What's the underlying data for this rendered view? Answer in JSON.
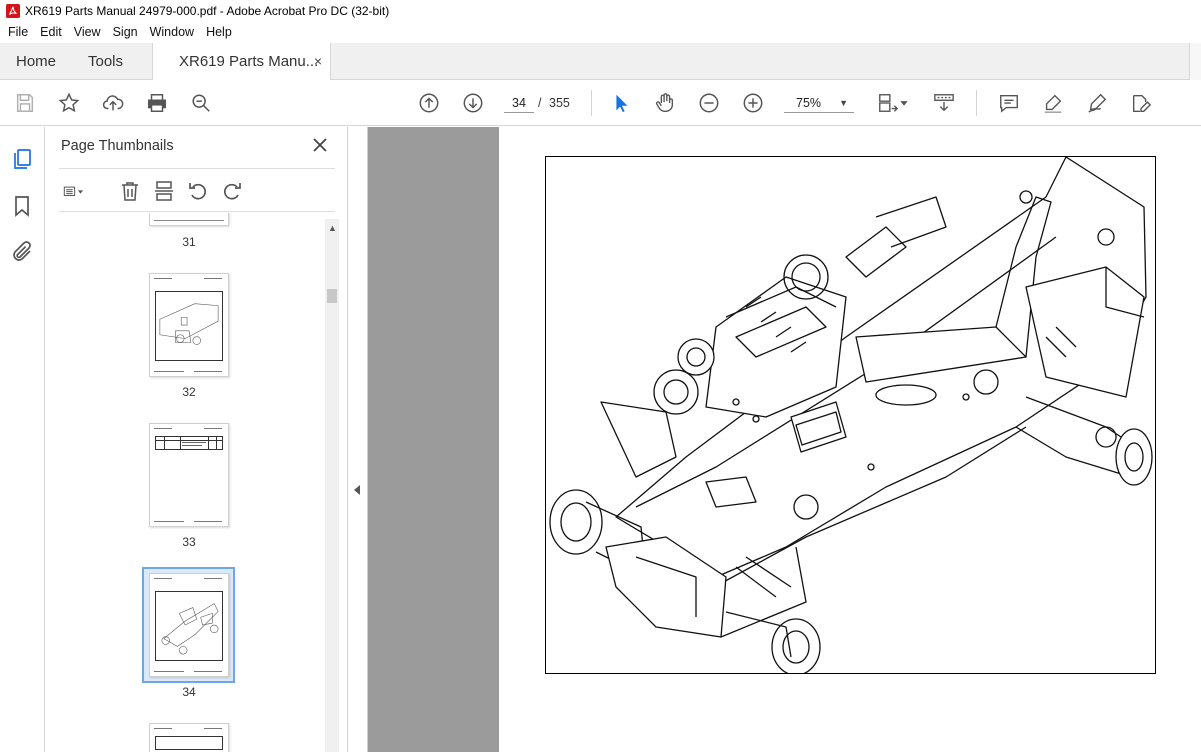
{
  "window": {
    "title": "XR619 Parts Manual 24979-000.pdf - Adobe Acrobat Pro DC (32-bit)"
  },
  "menu": [
    "File",
    "Edit",
    "View",
    "Sign",
    "Window",
    "Help"
  ],
  "tabs": {
    "home": "Home",
    "tools": "Tools",
    "document": "XR619 Parts Manu...",
    "close_glyph": "×"
  },
  "toolbar": {
    "current_page": "34",
    "page_separator": "/",
    "page_count": "355",
    "zoom": "75%"
  },
  "thumbnail_panel": {
    "title": "Page Thumbnails",
    "pages": [
      {
        "number": "31"
      },
      {
        "number": "32"
      },
      {
        "number": "33"
      },
      {
        "number": "34",
        "selected": true
      }
    ]
  },
  "colors": {
    "accent": "#1473e6",
    "selection": "#6fa6e8",
    "doc_background": "#9b9b9b"
  },
  "icons": [
    "acrobat-app-icon",
    "save-icon",
    "bookmark-star-icon",
    "upload-cloud-icon",
    "print-icon",
    "zoom-search-icon",
    "page-up-icon",
    "page-down-icon",
    "select-arrow-icon",
    "hand-tool-icon",
    "zoom-out-icon",
    "zoom-in-icon",
    "page-fit-icon",
    "scroll-mode-icon",
    "comment-icon",
    "highlight-pen-icon",
    "sign-icon",
    "edit-pdf-icon",
    "page-thumbnails-icon",
    "bookmarks-icon",
    "attachments-icon"
  ]
}
